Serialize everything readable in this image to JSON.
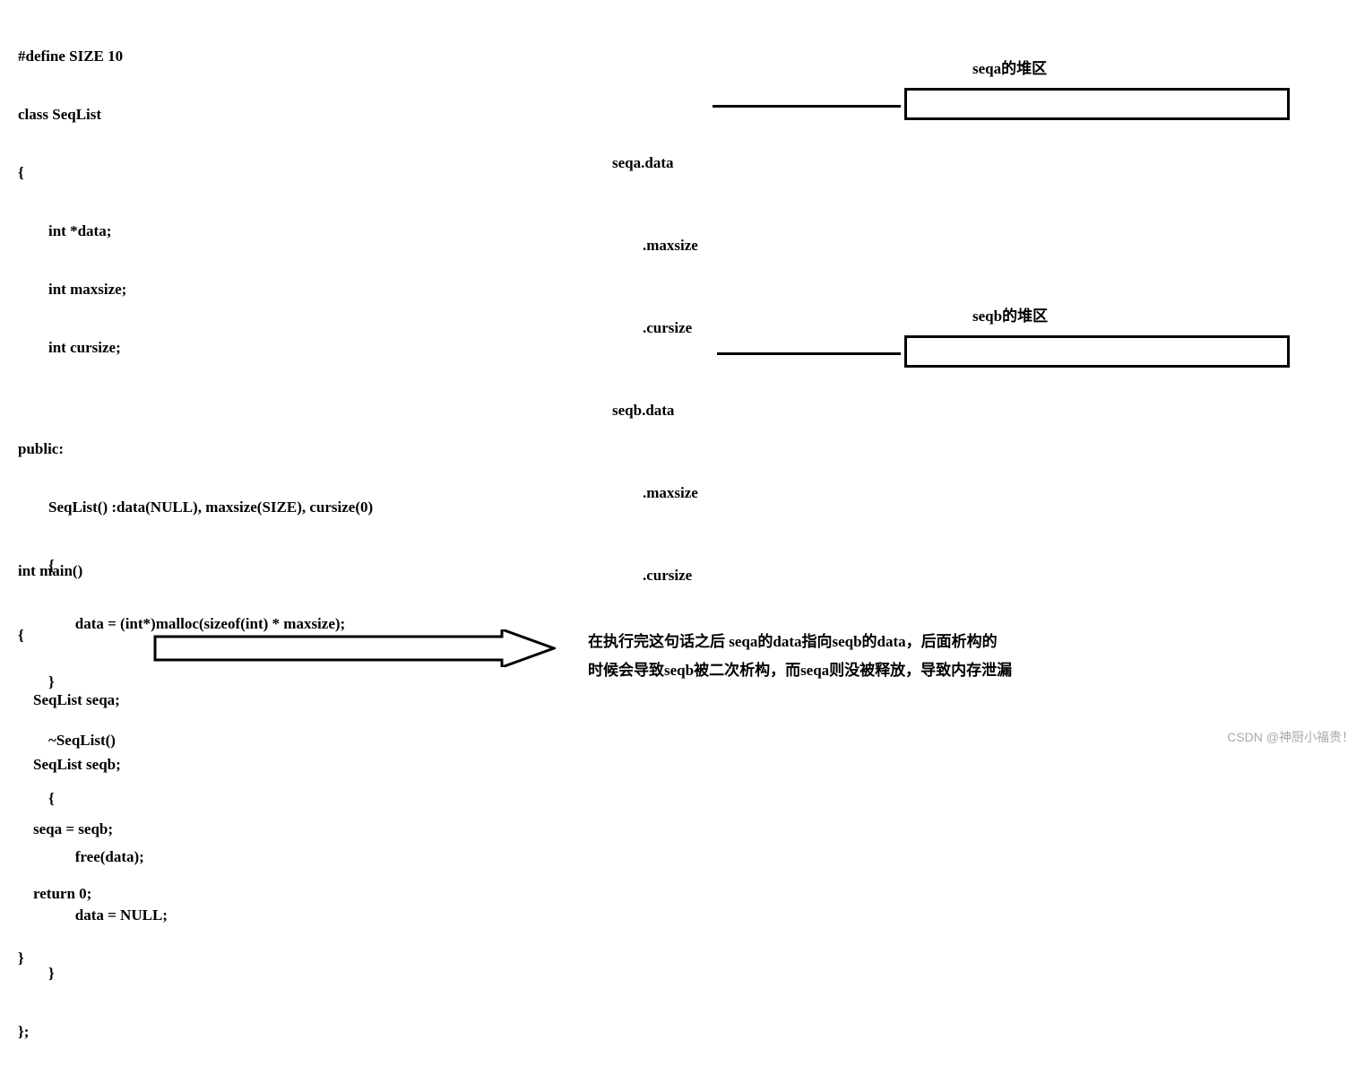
{
  "code": {
    "l1": "#define SIZE 10",
    "l2": "class SeqList",
    "l3": "{",
    "l4": "        int *data;",
    "l5": "        int maxsize;",
    "l6": "        int cursize;",
    "l7": "",
    "l8": "public:",
    "l9": "        SeqList() :data(NULL), maxsize(SIZE), cursize(0)",
    "l10": "        {",
    "l11": "               data = (int*)malloc(sizeof(int) * maxsize);",
    "l12": "        }",
    "l13": "        ~SeqList()",
    "l14": "        {",
    "l15": "               free(data);",
    "l16": "               data = NULL;",
    "l17": "        }",
    "l18": "};",
    "l19": "int main()",
    "l20": "{",
    "l21": "    SeqList seqa;",
    "l22": "    SeqList seqb;",
    "l23": "    seqa = seqb;",
    "l24": "    return 0;",
    "l25": "}"
  },
  "heap_a": {
    "title": "seqa的堆区",
    "label_data": "seqa.data",
    "label_maxsize": "        .maxsize",
    "label_cursize": "        .cursize"
  },
  "heap_b": {
    "title": "seqb的堆区",
    "label_data": "seqb.data",
    "label_maxsize": "        .maxsize",
    "label_cursize": "        .cursize"
  },
  "explain": {
    "line1": "在执行完这句话之后  seqa的data指向seqb的data，后面析构的",
    "line2": "时候会导致seqb被二次析构，而seqa则没被释放，导致内存泄漏"
  },
  "watermark": "CSDN @神厨小福贵！"
}
